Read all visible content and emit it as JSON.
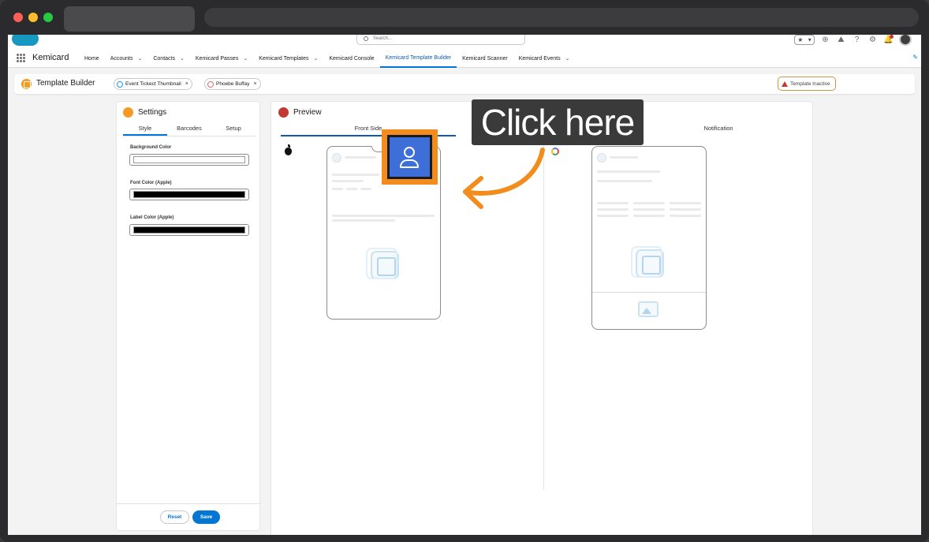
{
  "header": {
    "search_placeholder": "Search...",
    "app_name": "Kemicard"
  },
  "nav": {
    "items": [
      {
        "label": "Home",
        "dropdown": false,
        "active": false
      },
      {
        "label": "Accounts",
        "dropdown": true,
        "active": false
      },
      {
        "label": "Contacts",
        "dropdown": true,
        "active": false
      },
      {
        "label": "Kemicard Passes",
        "dropdown": true,
        "active": false
      },
      {
        "label": "Kemicard Templates",
        "dropdown": true,
        "active": false
      },
      {
        "label": "Kemicard Console",
        "dropdown": false,
        "active": false
      },
      {
        "label": "Kemicard Template Builder",
        "dropdown": false,
        "active": true
      },
      {
        "label": "Kemicard Scanner",
        "dropdown": false,
        "active": false
      },
      {
        "label": "Kemicard Events",
        "dropdown": true,
        "active": false
      }
    ]
  },
  "page": {
    "title": "Template Builder",
    "pills": [
      {
        "label": "Event Tickect Thumbnail",
        "color": "#1b96ff"
      },
      {
        "label": "Phoebe Buffay",
        "color": "#e16c7a"
      }
    ],
    "status": "Template Inactive"
  },
  "settings": {
    "title": "Settings",
    "icon_color": "#f59a23",
    "tabs": [
      "Style",
      "Barcodes",
      "Setup"
    ],
    "active_tab": "Style",
    "fields": [
      {
        "label": "Background Color",
        "value_color": "#ffffff"
      },
      {
        "label": "Font Color (Apple)",
        "value_color": "#000000"
      },
      {
        "label": "Label Color (Apple)",
        "value_color": "#000000"
      }
    ],
    "reset_label": "Reset",
    "save_label": "Save"
  },
  "preview": {
    "title": "Preview",
    "icon_color": "#c23934",
    "tabs": {
      "front": "Front Side",
      "notification": "Notification"
    }
  },
  "callout": {
    "text": "Click here",
    "accent": "#f28c1c"
  }
}
